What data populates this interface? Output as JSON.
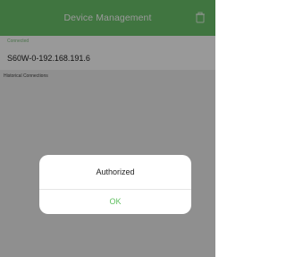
{
  "header": {
    "title": "Device Management",
    "delete_icon": "trash-icon"
  },
  "sections": {
    "connected_label": "Connected",
    "historical_label": "Historical Connections"
  },
  "device": {
    "name": "S60W-0-192.168.191.6"
  },
  "dialog": {
    "message": "Authorized",
    "ok_label": "OK"
  },
  "colors": {
    "header": "#6bc36b",
    "accent_green": "#5fbf5f"
  }
}
